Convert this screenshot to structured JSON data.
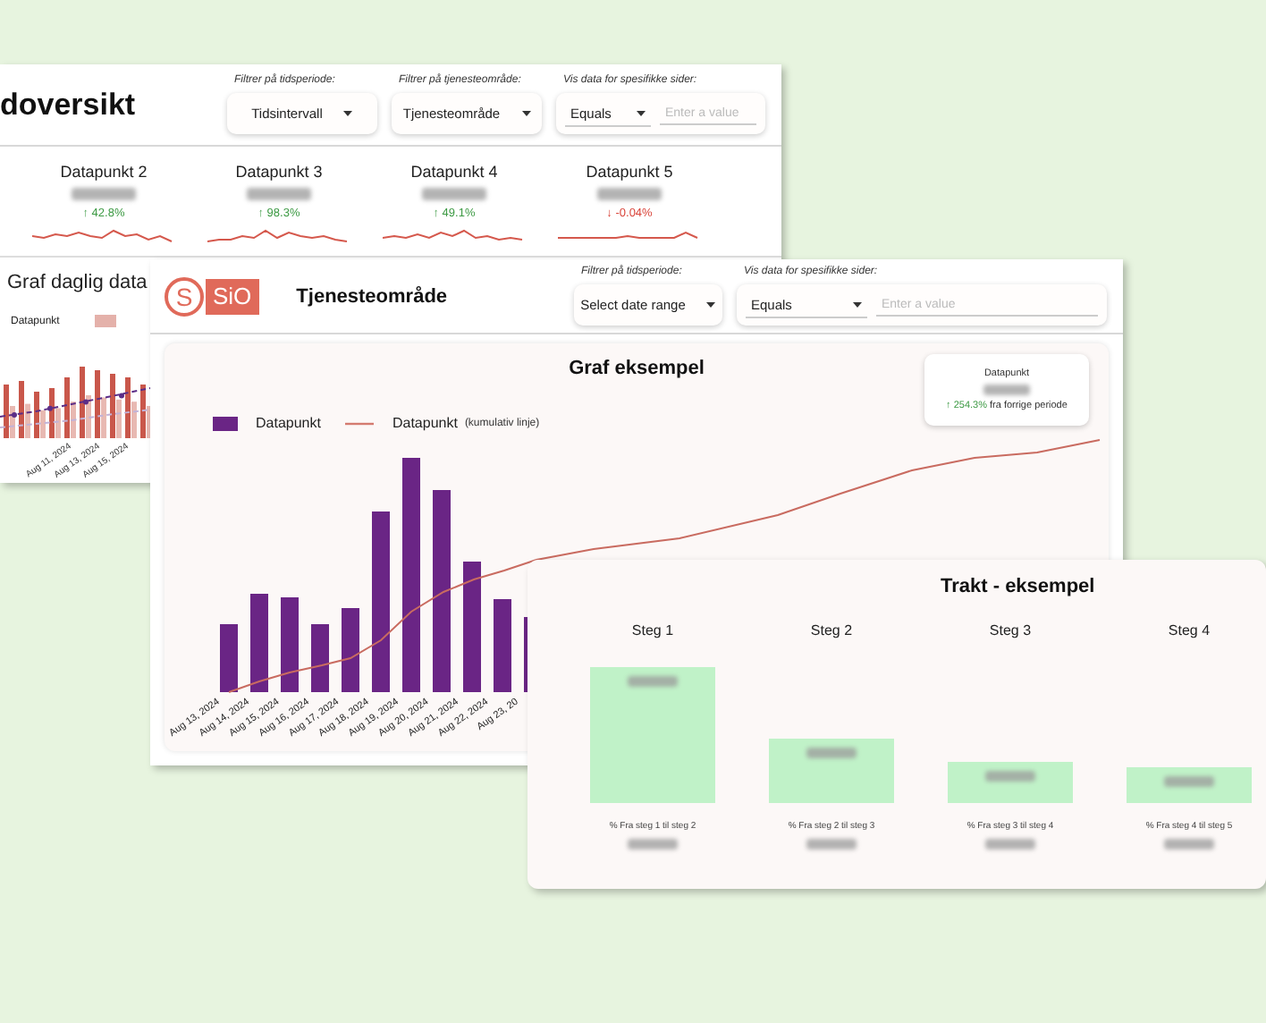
{
  "overview_window": {
    "title": "doversikt",
    "filters": [
      {
        "label": "Filtrer på tidsperiode:",
        "kind": "dropdown",
        "value": "Tidsintervall"
      },
      {
        "label": "Filtrer på tjenesteområde:",
        "kind": "dropdown",
        "value": "Tjenesteområde"
      },
      {
        "label": "Vis data for spesifikke sider:",
        "kind": "condition",
        "operator": "Equals",
        "placeholder": "Enter a value"
      }
    ],
    "kpis": [
      {
        "label": "Datapunkt 2",
        "change": "↑ 42.8%",
        "color": "#3d9a44"
      },
      {
        "label": "Datapunkt 3",
        "change": "↑ 98.3%",
        "color": "#3d9a44"
      },
      {
        "label": "Datapunkt 4",
        "change": "↑ 49.1%",
        "color": "#3d9a44"
      },
      {
        "label": "Datapunkt 5",
        "change": "↓ -0.04%",
        "color": "#d9443a"
      }
    ],
    "daily_chart": {
      "title": "Graf daglig data",
      "legend": "Datapunkt",
      "x_labels": [
        "Aug 11, 2024",
        "Aug 13, 2024",
        "Aug 15, 2024"
      ]
    }
  },
  "service_window": {
    "logo": {
      "mark": "S",
      "text": "SiO"
    },
    "title": "Tjenesteområde",
    "filters": [
      {
        "label": "Filtrer på tidsperiode:",
        "kind": "dropdown",
        "value": "Select date range"
      },
      {
        "label": "Vis data for spesifikke sider:",
        "kind": "condition",
        "operator": "Equals",
        "placeholder": "Enter a value"
      }
    ],
    "chart": {
      "title": "Graf eksempel",
      "legend": [
        {
          "label": "Datapunkt",
          "kind": "bar"
        },
        {
          "label": "Datapunkt",
          "kind": "line",
          "note": "(kumulativ linje)"
        }
      ],
      "x_labels": [
        "Aug 13, 2024",
        "Aug 14, 2024",
        "Aug 15, 2024",
        "Aug 16, 2024",
        "Aug 17, 2024",
        "Aug 18, 2024",
        "Aug 19, 2024",
        "Aug 20, 2024",
        "Aug 21, 2024",
        "Aug 22, 2024",
        "Aug 23, 20"
      ]
    },
    "kpi_card": {
      "label": "Datapunkt",
      "change": "↑ 254.3%",
      "suffix": "fra forrige periode"
    }
  },
  "funnel_window": {
    "title": "Trakt - eksempel",
    "steps": [
      {
        "label": "Steg 1",
        "caption": "% Fra steg 1 til steg 2"
      },
      {
        "label": "Steg 2",
        "caption": "% Fra steg 2 til steg 3"
      },
      {
        "label": "Steg 3",
        "caption": "% Fra steg 3 til steg 4"
      },
      {
        "label": "Steg 4",
        "caption": "% Fra steg 4 til steg 5"
      }
    ]
  }
}
